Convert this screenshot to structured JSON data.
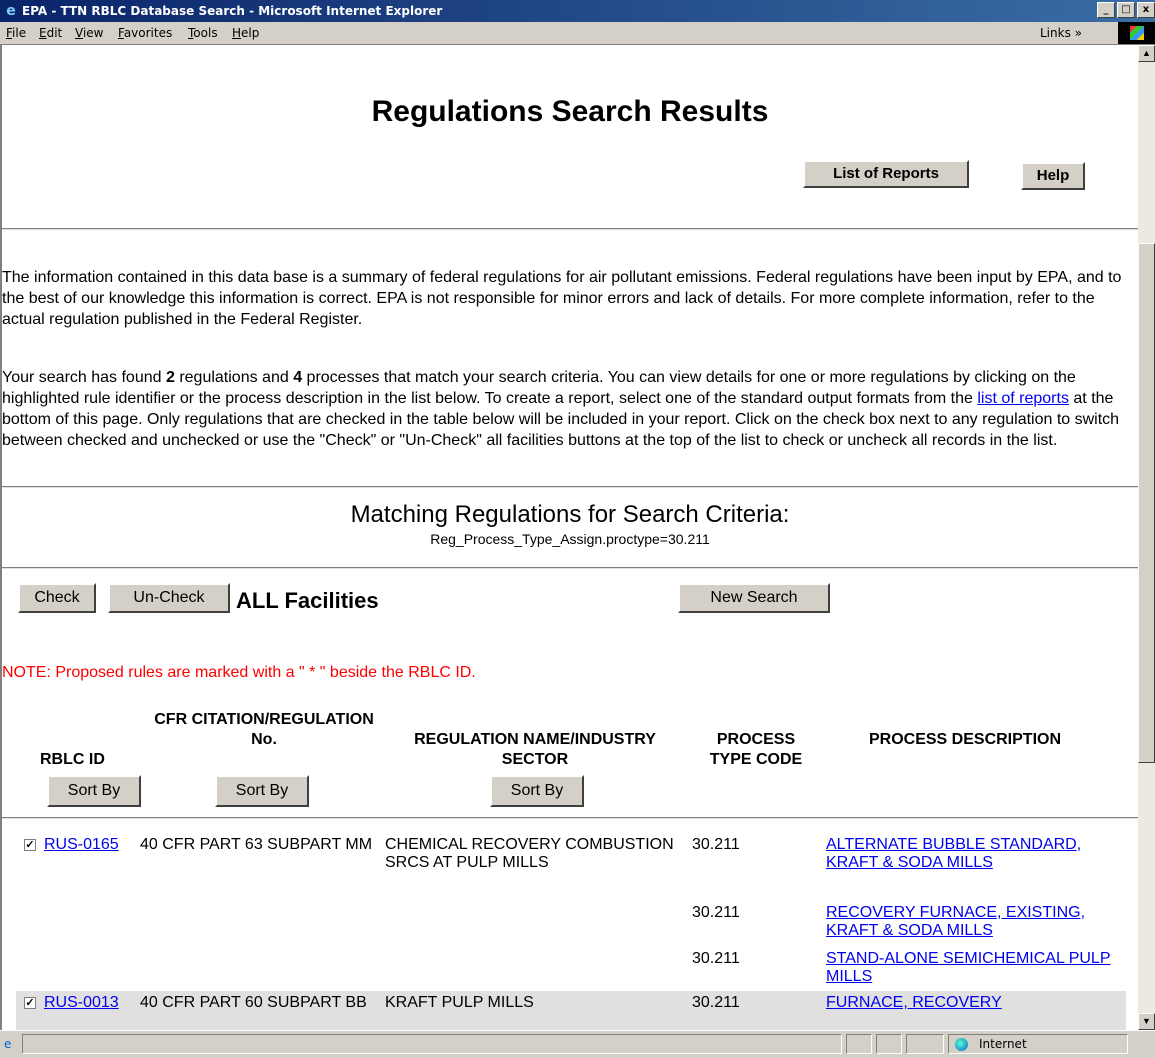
{
  "window": {
    "title": "EPA - TTN RBLC Database Search - Microsoft Internet Explorer",
    "minimize": "_",
    "maximize": "□",
    "close": "x"
  },
  "menu": {
    "items": [
      "File",
      "Edit",
      "View",
      "Favorites",
      "Tools",
      "Help"
    ],
    "links": "Links »"
  },
  "page": {
    "title": "Regulations Search Results",
    "list_of_reports_button": "List of Reports",
    "help_button": "Help",
    "intro_paragraph": "The information contained in this data base is a summary of federal regulations for air pollutant emissions. Federal regulations have been input by EPA, and to the best of our knowledge this information is correct. EPA is not responsible for minor errors and lack of details. For more complete information, refer to the actual regulation published in the Federal Register.",
    "search_para": {
      "part1": "Your search has found ",
      "reg_count": "2",
      "part2": " regulations and ",
      "proc_count": "4",
      "part3": " processes that match your search criteria. You can view details for one or more regulations by clicking on the highlighted rule identifier or the process description in the list below. To create a report, select one of the standard output formats from the ",
      "link_text": "list of reports",
      "part4": " at the bottom of this page. Only regulations that are checked in the table below will be included in your report. Click on the check box next to any regulation to switch between checked and unchecked or use the \"Check\" or \"Un-Check\" all facilities buttons at the top of the list to check or uncheck all records in the list."
    },
    "matching_heading": "Matching Regulations for Search Criteria:",
    "criteria": "Reg_Process_Type_Assign.proctype=30.211",
    "check_button": "Check",
    "uncheck_button": "Un-Check",
    "all_facilities": "ALL Facilities",
    "new_search_button": "New Search",
    "note": "NOTE: Proposed rules are marked with a \" * \" beside the RBLC ID."
  },
  "table": {
    "headers": {
      "rblc_id": "RBLC ID",
      "cfr": "CFR CITATION/REGULATION No.",
      "name": "REGULATION NAME/INDUSTRY SECTOR",
      "ptc": "PROCESS TYPE CODE",
      "pdesc": "PROCESS DESCRIPTION"
    },
    "sort_label": "Sort By",
    "rows": [
      {
        "checked": "✓",
        "id": "RUS-0165",
        "cfr": "40 CFR PART 63 SUBPART MM",
        "name": "CHEMICAL RECOVERY COMBUSTION SRCS AT PULP MILLS",
        "processes": [
          {
            "code": "30.211",
            "desc": "ALTERNATE BUBBLE STANDARD, KRAFT & SODA MILLS"
          },
          {
            "code": "30.211",
            "desc": "RECOVERY FURNACE, EXISTING, KRAFT & SODA MILLS"
          },
          {
            "code": "30.211",
            "desc": "STAND-ALONE SEMICHEMICAL PULP MILLS"
          }
        ]
      },
      {
        "checked": "✓",
        "id": "RUS-0013",
        "cfr": "40 CFR PART 60 SUBPART BB",
        "name": "KRAFT PULP MILLS",
        "processes": [
          {
            "code": "30.211",
            "desc": "FURNACE, RECOVERY"
          }
        ]
      }
    ]
  },
  "status": {
    "zone": "Internet"
  },
  "colors": {
    "titlebar": "#0a246a",
    "link": "#0000ee",
    "note": "#ff0000",
    "row_alt": "#e0e0e0"
  }
}
